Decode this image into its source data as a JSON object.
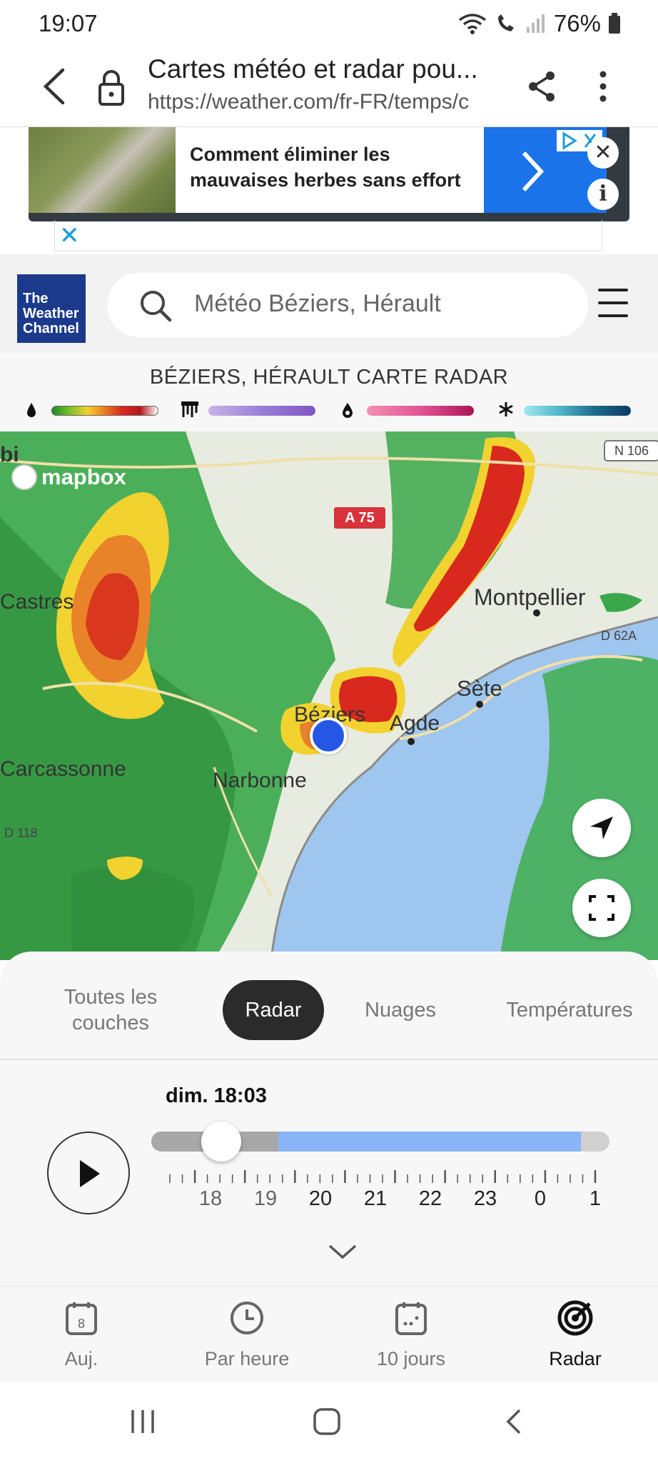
{
  "status": {
    "time": "19:07",
    "battery": "76%"
  },
  "browser": {
    "title": "Cartes météo et radar pou...",
    "url": "https://weather.com/fr-FR/temps/c"
  },
  "ad": {
    "text": "Comment éliminer les mauvaises herbes sans effort"
  },
  "header": {
    "logo": "The Weather Channel",
    "search_placeholder": "Météo Béziers, Hérault"
  },
  "radar": {
    "title": "BÉZIERS, HÉRAULT CARTE RADAR",
    "legend": [
      {
        "icon": "raindrop-icon",
        "colors": [
          "#1a8a2a",
          "#f2d22e",
          "#d9281e",
          "#ffffff"
        ]
      },
      {
        "icon": "ice-icon",
        "colors": [
          "#b39ddb",
          "#7e57c2"
        ]
      },
      {
        "icon": "mix-icon",
        "colors": [
          "#f06292",
          "#ad1457"
        ]
      },
      {
        "icon": "snowflake-icon",
        "colors": [
          "#80deea",
          "#0d3b66"
        ]
      }
    ]
  },
  "map": {
    "attribution": "mapbox",
    "road_a75": "A 75",
    "road_n106": "N 106",
    "road_d62a": "D 62A",
    "road_d118": "D 118",
    "cities": {
      "castres": "Castres",
      "montpellier": "Montpellier",
      "sete": "Sète",
      "beziers": "Béziers",
      "agde": "Agde",
      "carcassonne": "Carcassonne",
      "narbonne": "Narbonne",
      "edge": "bi"
    }
  },
  "layers": {
    "tabs": [
      "Toutes les couches",
      "Radar",
      "Nuages",
      "Températures"
    ],
    "active": "Radar"
  },
  "timeline": {
    "current": "dim. 18:03",
    "hours": [
      "18",
      "19",
      "20",
      "21",
      "22",
      "23",
      "0",
      "1"
    ],
    "progress": 0.12
  },
  "nav": {
    "items": [
      {
        "label": "Auj.",
        "icon": "calendar-day-icon",
        "badge": "8"
      },
      {
        "label": "Par heure",
        "icon": "clock-icon"
      },
      {
        "label": "10 jours",
        "icon": "calendar-dots-icon"
      },
      {
        "label": "Radar",
        "icon": "radar-icon"
      }
    ],
    "active": "Radar"
  }
}
